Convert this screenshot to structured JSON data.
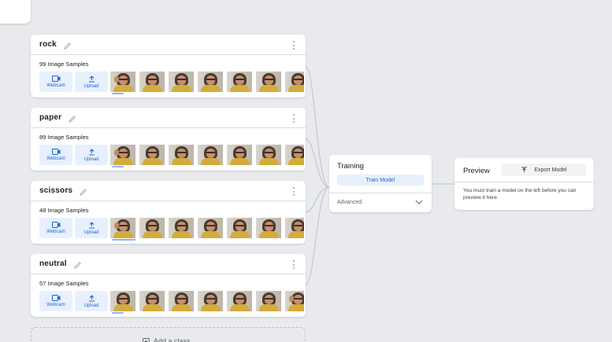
{
  "classes": [
    {
      "name": "rock",
      "samples": "99 Image Samples",
      "webcam": "Webcam",
      "upload": "Upload"
    },
    {
      "name": "paper",
      "samples": "89 Image Samples",
      "webcam": "Webcam",
      "upload": "Upload"
    },
    {
      "name": "scissors",
      "samples": "48 Image Samples",
      "webcam": "Webcam",
      "upload": "Upload"
    },
    {
      "name": "neutral",
      "samples": "57 Image Samples",
      "webcam": "Webcam",
      "upload": "Upload"
    }
  ],
  "training": {
    "title": "Training",
    "train_button": "Train Model",
    "advanced": "Advanced"
  },
  "preview": {
    "title": "Preview",
    "export_button": "Export Model",
    "message": "You must train a model on the left before you can preview it here."
  },
  "add_class": "Add a class",
  "icons": {
    "webcam": "webcam-icon",
    "upload": "upload-icon",
    "edit": "pencil-icon",
    "more": "more-vert-icon",
    "chevron": "chevron-down-icon",
    "export": "export-icon",
    "add": "add-box-icon"
  },
  "colors": {
    "accent": "#1967d2",
    "accent_light": "#e8f0fe",
    "background": "#e8eaed"
  }
}
